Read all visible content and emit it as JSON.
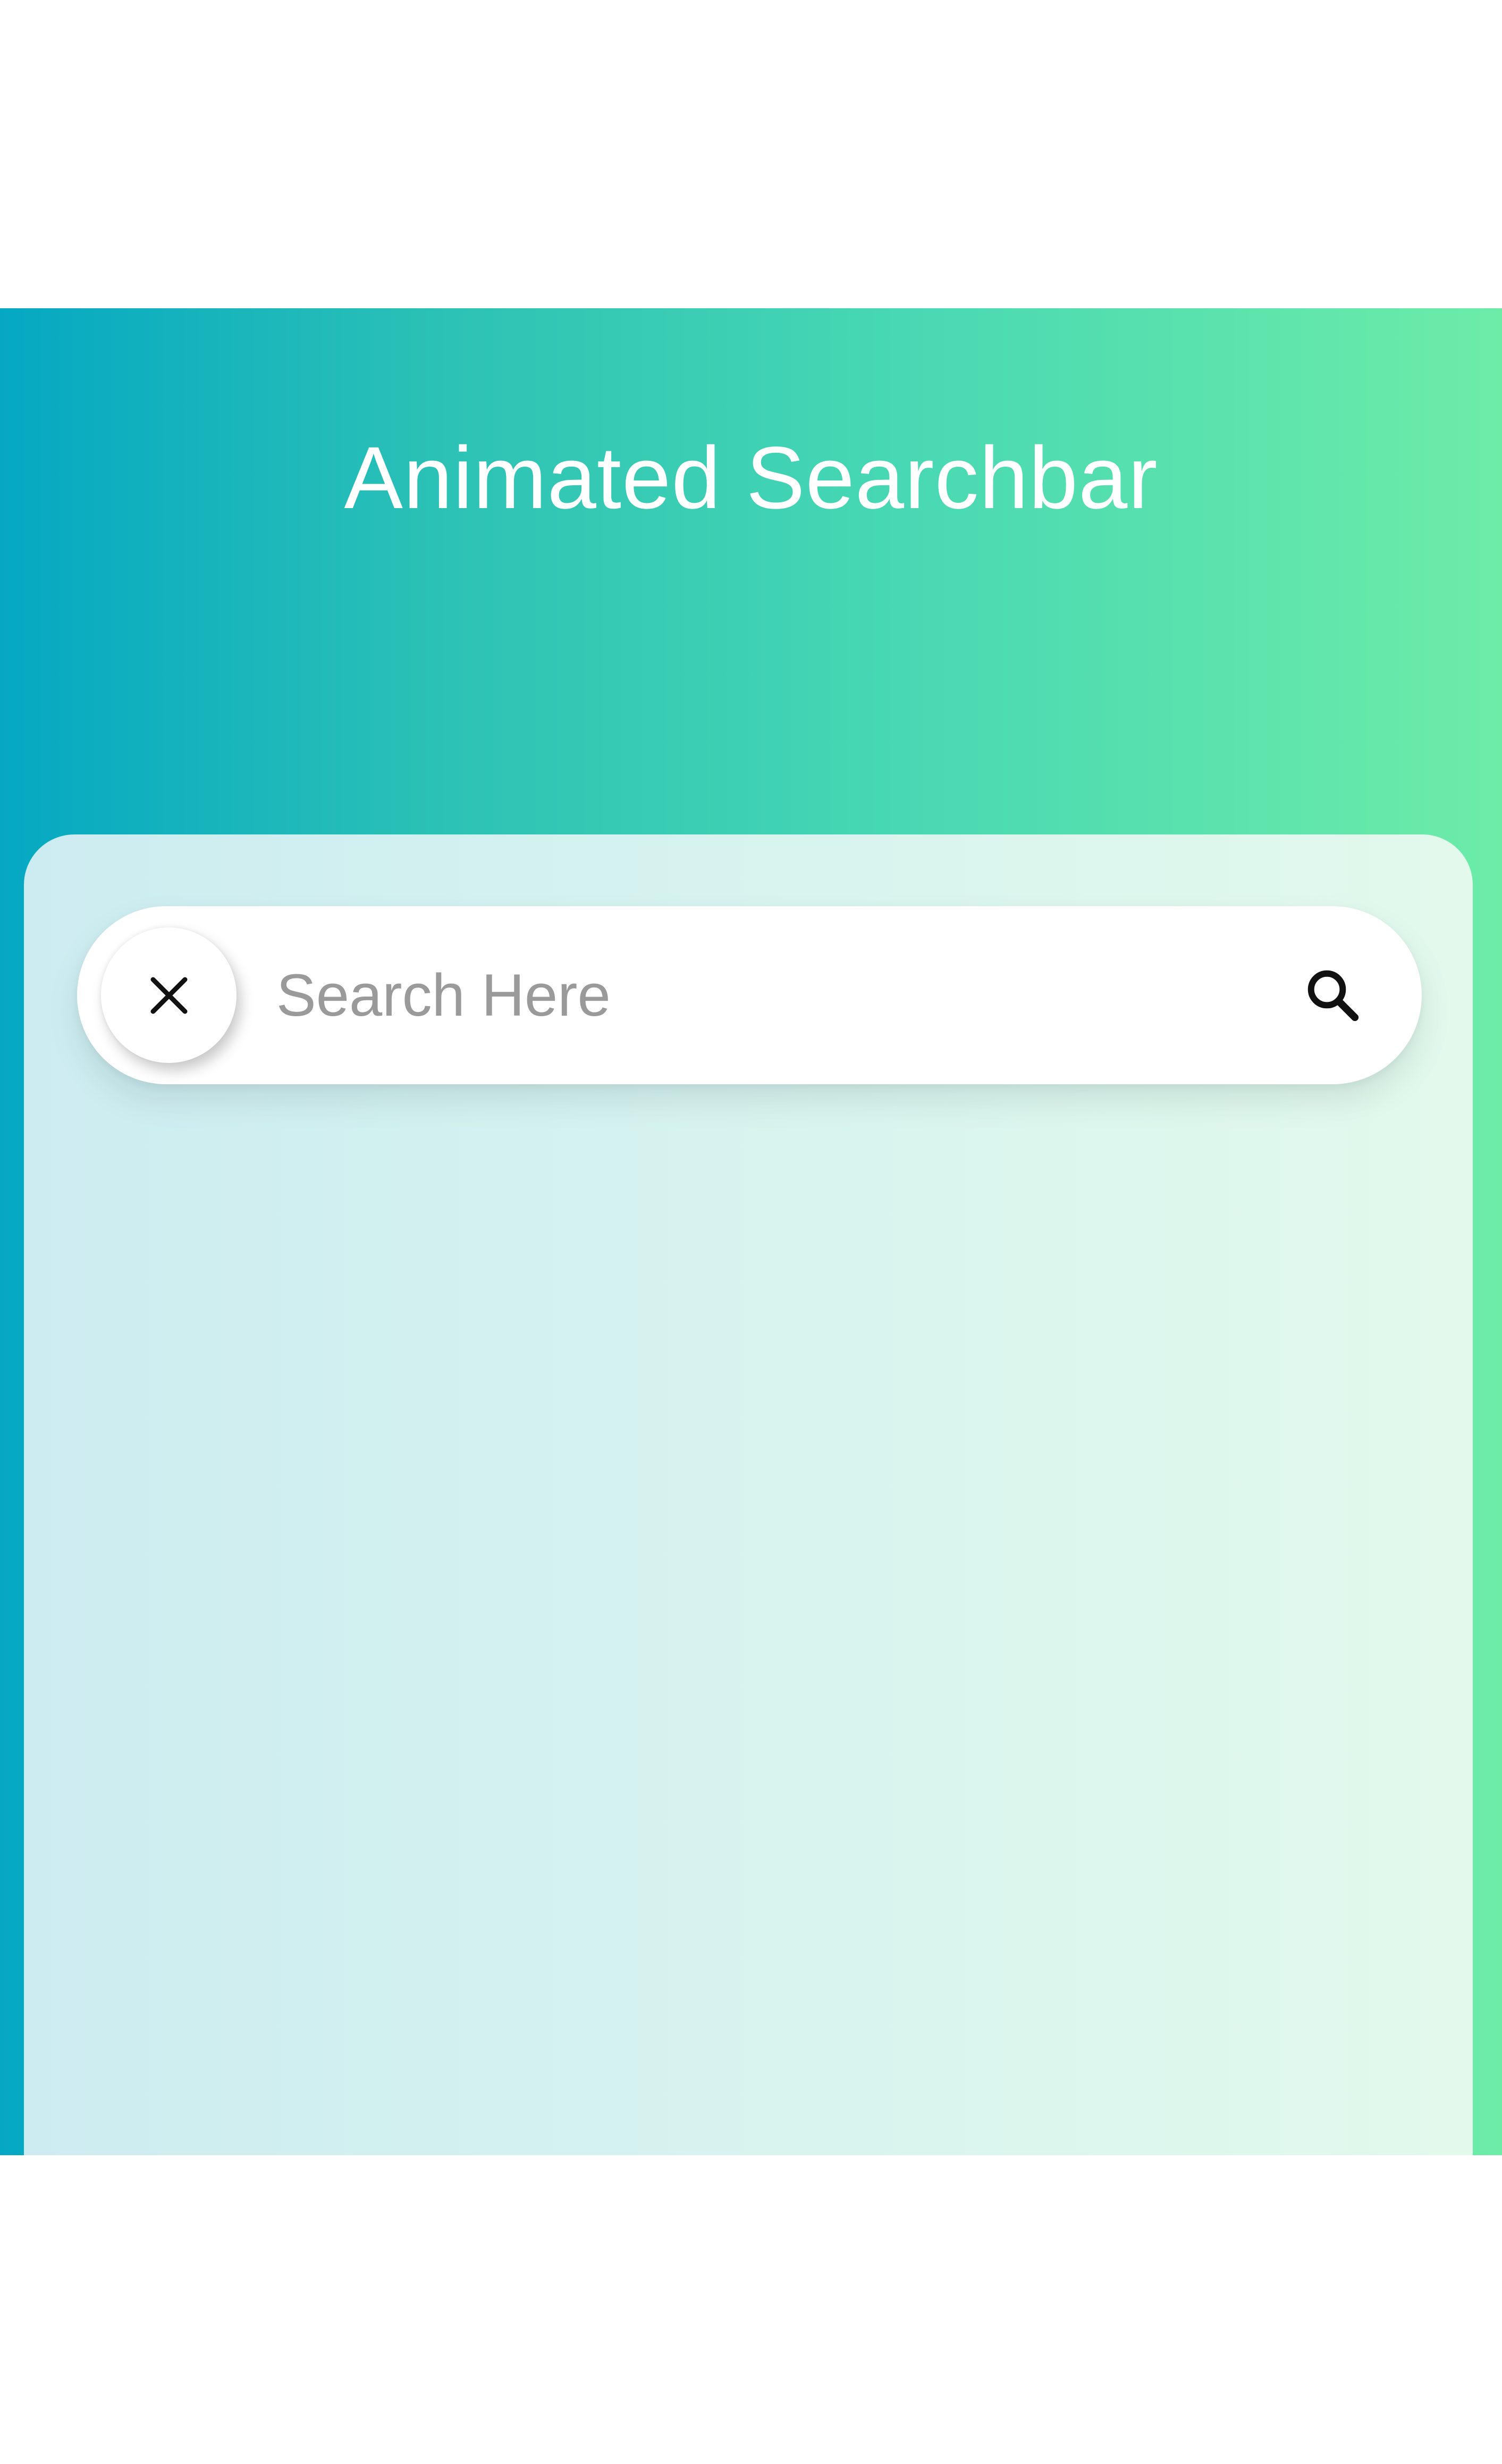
{
  "header": {
    "title": "Animated Searchbar"
  },
  "searchbar": {
    "value": "",
    "placeholder": "Search Here",
    "close_icon": "close-icon",
    "search_icon": "search-icon"
  },
  "colors": {
    "gradient_start": "#05a8c3",
    "gradient_end": "#6deca8",
    "card_start": "#cdecf1",
    "card_end": "#e2f9ec",
    "searchbar_bg": "#ffffff",
    "title_text": "#ffffff",
    "placeholder_text": "#9a9a9a",
    "icon_color": "#111111"
  }
}
